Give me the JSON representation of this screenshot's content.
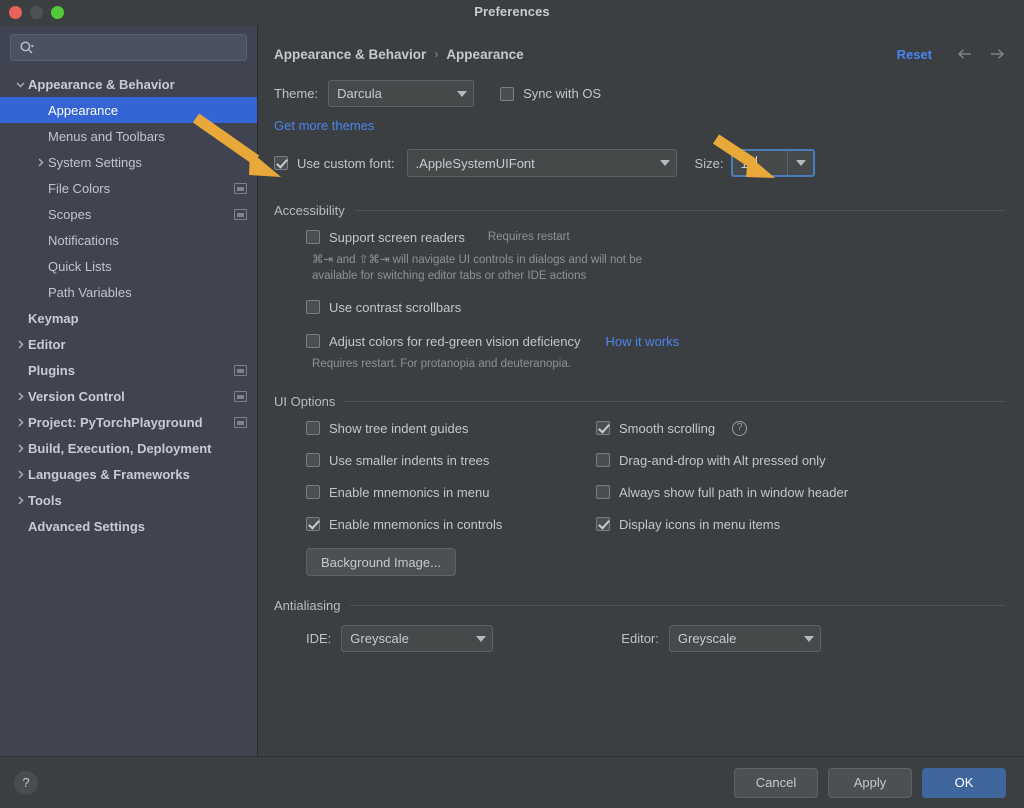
{
  "window": {
    "title": "Preferences",
    "traffic_lights": [
      "close",
      "minimize",
      "maximize"
    ]
  },
  "sidebar": {
    "search": {
      "value": "",
      "placeholder": ""
    },
    "items": [
      {
        "label": "Appearance & Behavior",
        "level": 0,
        "bold": true,
        "twisty": "down",
        "selected": false,
        "ext_icon": false
      },
      {
        "label": "Appearance",
        "level": 1,
        "bold": false,
        "twisty": "none",
        "selected": true,
        "ext_icon": false
      },
      {
        "label": "Menus and Toolbars",
        "level": 1,
        "bold": false,
        "twisty": "none",
        "selected": false,
        "ext_icon": false
      },
      {
        "label": "System Settings",
        "level": 1,
        "bold": false,
        "twisty": "right",
        "selected": false,
        "ext_icon": false
      },
      {
        "label": "File Colors",
        "level": 1,
        "bold": false,
        "twisty": "none",
        "selected": false,
        "ext_icon": true
      },
      {
        "label": "Scopes",
        "level": 1,
        "bold": false,
        "twisty": "none",
        "selected": false,
        "ext_icon": true
      },
      {
        "label": "Notifications",
        "level": 1,
        "bold": false,
        "twisty": "none",
        "selected": false,
        "ext_icon": false
      },
      {
        "label": "Quick Lists",
        "level": 1,
        "bold": false,
        "twisty": "none",
        "selected": false,
        "ext_icon": false
      },
      {
        "label": "Path Variables",
        "level": 1,
        "bold": false,
        "twisty": "none",
        "selected": false,
        "ext_icon": false
      },
      {
        "label": "Keymap",
        "level": 0,
        "bold": true,
        "twisty": "none",
        "selected": false,
        "ext_icon": false
      },
      {
        "label": "Editor",
        "level": 0,
        "bold": true,
        "twisty": "right",
        "selected": false,
        "ext_icon": false
      },
      {
        "label": "Plugins",
        "level": 0,
        "bold": true,
        "twisty": "none",
        "selected": false,
        "ext_icon": true
      },
      {
        "label": "Version Control",
        "level": 0,
        "bold": true,
        "twisty": "right",
        "selected": false,
        "ext_icon": true
      },
      {
        "label": "Project: PyTorchPlayground",
        "level": 0,
        "bold": true,
        "twisty": "right",
        "selected": false,
        "ext_icon": true
      },
      {
        "label": "Build, Execution, Deployment",
        "level": 0,
        "bold": true,
        "twisty": "right",
        "selected": false,
        "ext_icon": false
      },
      {
        "label": "Languages & Frameworks",
        "level": 0,
        "bold": true,
        "twisty": "right",
        "selected": false,
        "ext_icon": false
      },
      {
        "label": "Tools",
        "level": 0,
        "bold": true,
        "twisty": "right",
        "selected": false,
        "ext_icon": false
      },
      {
        "label": "Advanced Settings",
        "level": 0,
        "bold": true,
        "twisty": "none",
        "selected": false,
        "ext_icon": false
      }
    ]
  },
  "header": {
    "breadcrumb": [
      "Appearance & Behavior",
      "Appearance"
    ],
    "separator": "›",
    "reset_label": "Reset",
    "back_icon": "arrow-left-icon",
    "forward_icon": "arrow-right-icon"
  },
  "theme": {
    "label": "Theme:",
    "value": "Darcula",
    "sync_with_os_label": "Sync with OS",
    "sync_with_os_checked": false,
    "get_more_themes_label": "Get more themes"
  },
  "font": {
    "use_custom_font_label": "Use custom font:",
    "use_custom_font_checked": true,
    "font_value": ".AppleSystemUIFont",
    "size_label": "Size:",
    "size_value": "14"
  },
  "accessibility": {
    "title": "Accessibility",
    "screen_readers_label": "Support screen readers",
    "screen_readers_checked": false,
    "screen_readers_hint": "Requires restart",
    "screen_readers_detail_line1": "⌘⇥ and ⇧⌘⇥ will navigate UI controls in dialogs and will not be",
    "screen_readers_detail_line2": "available for switching editor tabs or other IDE actions",
    "contrast_scrollbars_label": "Use contrast scrollbars",
    "contrast_scrollbars_checked": false,
    "adjust_colors_label": "Adjust colors for red-green vision deficiency",
    "adjust_colors_checked": false,
    "how_it_works_label": "How it works",
    "adjust_colors_detail": "Requires restart. For protanopia and deuteranopia."
  },
  "ui_options": {
    "title": "UI Options",
    "left_column": [
      {
        "label": "Show tree indent guides",
        "checked": false
      },
      {
        "label": "Use smaller indents in trees",
        "checked": false
      },
      {
        "label": "Enable mnemonics in menu",
        "checked": false
      },
      {
        "label": "Enable mnemonics in controls",
        "checked": true
      }
    ],
    "right_column": [
      {
        "label": "Smooth scrolling",
        "checked": true,
        "help": true
      },
      {
        "label": "Drag-and-drop with Alt pressed only",
        "checked": false,
        "help": false
      },
      {
        "label": "Always show full path in window header",
        "checked": false,
        "help": false
      },
      {
        "label": "Display icons in menu items",
        "checked": true,
        "help": false
      }
    ],
    "background_image_button": "Background Image..."
  },
  "antialiasing": {
    "title": "Antialiasing",
    "ide_label": "IDE:",
    "ide_value": "Greyscale",
    "editor_label": "Editor:",
    "editor_value": "Greyscale"
  },
  "footer": {
    "help_label": "?",
    "cancel_label": "Cancel",
    "apply_label": "Apply",
    "ok_label": "OK"
  },
  "colors": {
    "accent_blue": "#3565d4",
    "link_blue": "#4b84f0",
    "ok_blue": "#3f679e",
    "annotation_orange": "#e8a93a",
    "sidebar_bg": "#3f4450",
    "content_bg": "#3c3f41"
  }
}
